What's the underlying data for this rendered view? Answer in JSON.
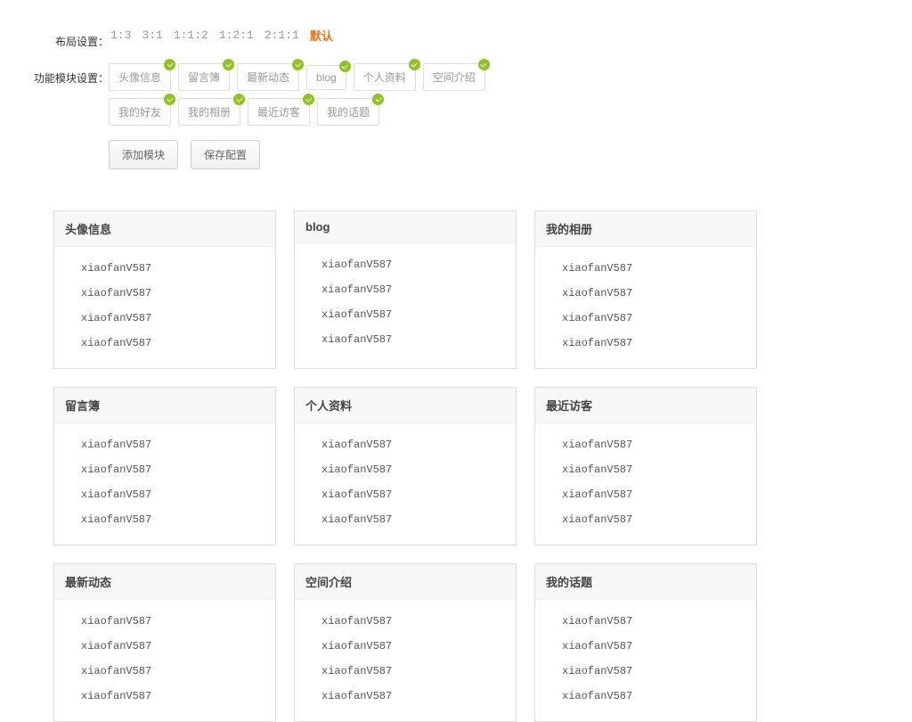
{
  "settings": {
    "layout_label": "布局设置：",
    "layout_options": [
      "1:3",
      "3:1",
      "1:1:2",
      "1:2:1",
      "2:1:1",
      "默认"
    ],
    "layout_active_index": 5,
    "module_label": "功能模块设置：",
    "module_tags": [
      "头像信息",
      "留言簿",
      "最新动态",
      "blog",
      "个人资料",
      "空间介绍",
      "我的好友",
      "我的相册",
      "最近访客",
      "我的话题"
    ],
    "add_module_label": "添加模块",
    "save_config_label": "保存配置"
  },
  "sample_item": "xiaofanV587",
  "panels": [
    {
      "title": "头像信息"
    },
    {
      "title": "blog"
    },
    {
      "title": "我的相册"
    },
    {
      "title": "留言簿"
    },
    {
      "title": "个人资料"
    },
    {
      "title": "最近访客"
    },
    {
      "title": "最新动态"
    },
    {
      "title": "空间介绍"
    },
    {
      "title": "我的话题"
    }
  ]
}
